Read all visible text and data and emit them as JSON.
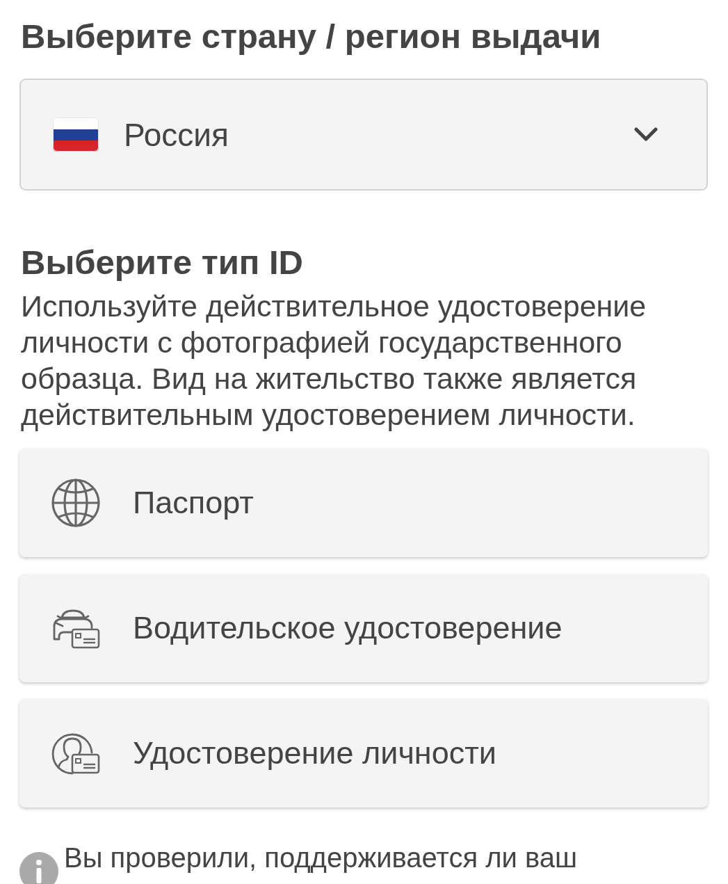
{
  "country_section": {
    "title": "Выберите страну / регион выдачи",
    "select": {
      "value": "Россия"
    }
  },
  "id_section": {
    "title": "Выберите тип ID",
    "description": "Используйте действительное удостоверение личности с фотографией государственного образца. Вид на жительство также является действительным удостоверением личности.",
    "options": [
      {
        "kind": "passport",
        "label": "Паспорт"
      },
      {
        "kind": "drivers_license",
        "label": "Водительское удостоверение"
      },
      {
        "kind": "id_card",
        "label": "Удостоверение личности"
      }
    ]
  },
  "notice": {
    "text": "Вы проверили, поддерживается ли ваш"
  }
}
